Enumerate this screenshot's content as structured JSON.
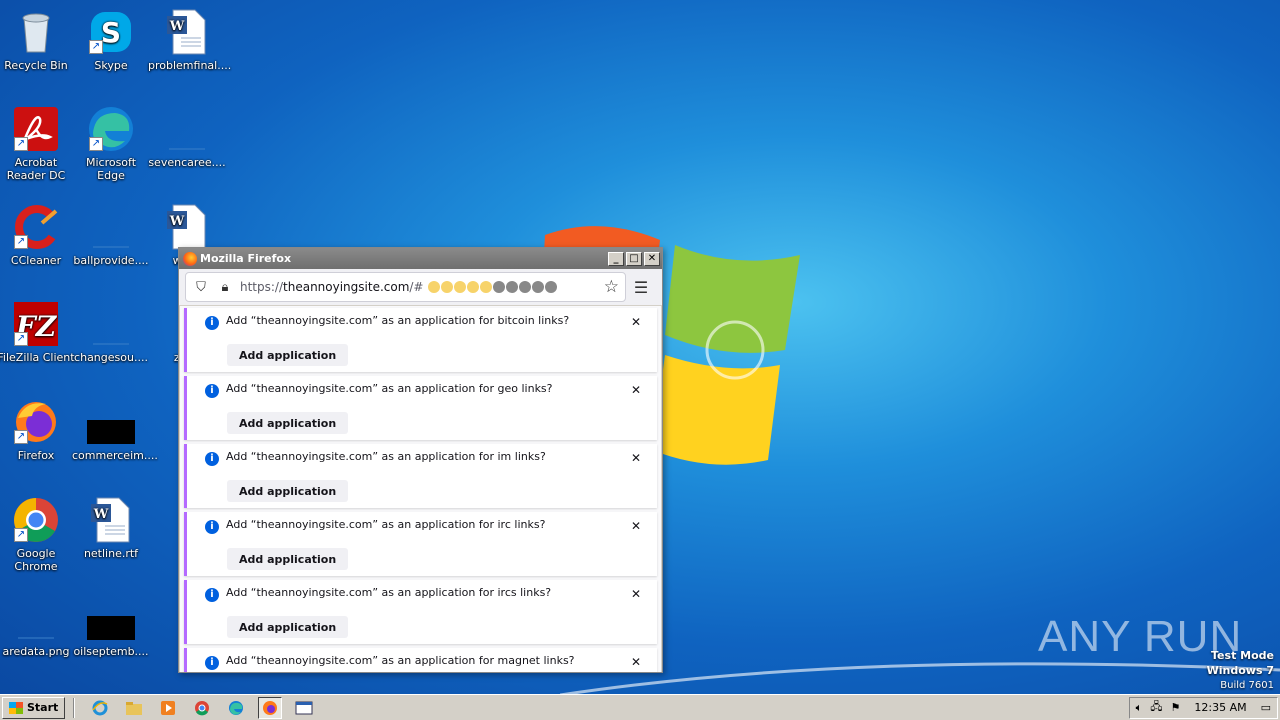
{
  "desktop": {
    "icons": [
      {
        "label": "Recycle Bin",
        "icon": "recycle-bin-icon"
      },
      {
        "label": "Skype",
        "icon": "skype-icon"
      },
      {
        "label": "problemfinal....",
        "icon": "word-document-icon"
      },
      {
        "label": "Acrobat Reader DC",
        "icon": "acrobat-icon"
      },
      {
        "label": "Microsoft Edge",
        "icon": "edge-icon"
      },
      {
        "label": "sevencaree....",
        "icon": "blank-file-icon"
      },
      {
        "label": "CCleaner",
        "icon": "ccleaner-icon"
      },
      {
        "label": "ballprovide....",
        "icon": "blank-file-icon"
      },
      {
        "label": "wedc",
        "icon": "word-document-icon"
      },
      {
        "label": "FileZilla Client",
        "icon": "filezilla-icon"
      },
      {
        "label": "changesou....",
        "icon": "blank-file-icon"
      },
      {
        "label": "zone",
        "icon": "blank-file-icon"
      },
      {
        "label": "Firefox",
        "icon": "firefox-icon"
      },
      {
        "label": "commerceim....",
        "icon": "black-file-icon"
      },
      {
        "label": "Google Chrome",
        "icon": "chrome-icon"
      },
      {
        "label": "netline.rtf",
        "icon": "word-document-icon"
      },
      {
        "label": "aredata.png",
        "icon": "blank-file-icon"
      },
      {
        "label": "oilseptemb....",
        "icon": "black-file-icon"
      }
    ]
  },
  "firefox": {
    "title": "Mozilla Firefox",
    "url_scheme": "https://",
    "url_host": "theannoyingsite.com",
    "url_suffix": "/#",
    "notification_button": "Add application",
    "notifications": [
      "Add “theannoyingsite.com” as an application for bitcoin links?",
      "Add “theannoyingsite.com” as an application for geo links?",
      "Add “theannoyingsite.com” as an application for im links?",
      "Add “theannoyingsite.com” as an application for irc links?",
      "Add “theannoyingsite.com” as an application for ircs links?",
      "Add “theannoyingsite.com” as an application for magnet links?"
    ]
  },
  "watermark": {
    "brand": "ANY RUN",
    "line1": "Test Mode",
    "line2": "Windows 7",
    "line3": "Build 7601"
  },
  "taskbar": {
    "start_label": "Start",
    "clock": "12:35 AM"
  }
}
